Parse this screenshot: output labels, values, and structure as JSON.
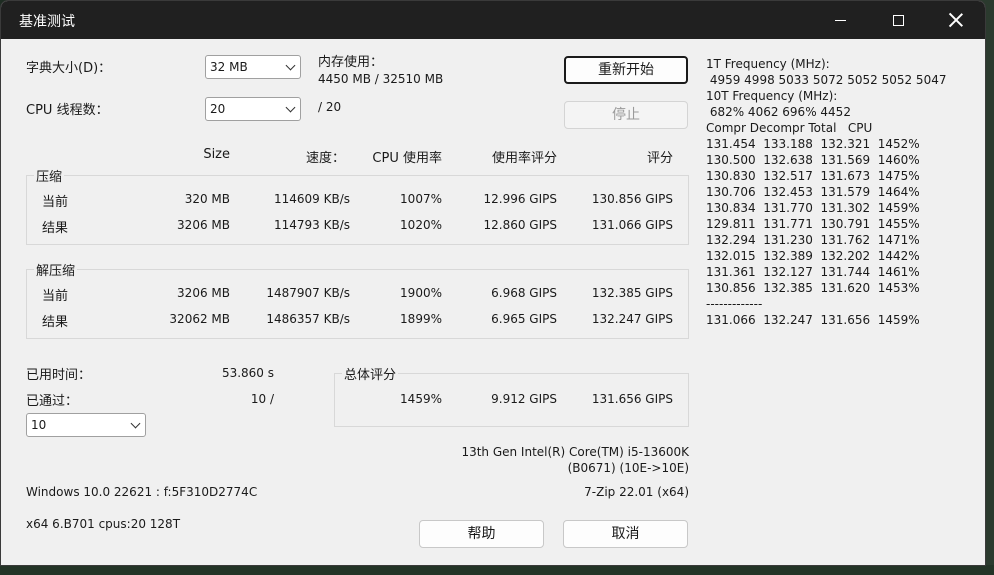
{
  "window": {
    "title": "基准测试"
  },
  "settings": {
    "dict_label": "字典大小(D)：",
    "dict_value": "32 MB",
    "threads_label": "CPU 线程数：",
    "threads_value": "20",
    "threads_max": "/ 20",
    "mem_label": "内存使用：",
    "mem_value": "4450 MB / 32510 MB"
  },
  "buttons": {
    "restart": "重新开始",
    "stop": "停止",
    "help": "帮助",
    "cancel": "取消"
  },
  "columns": {
    "size": "Size",
    "speed": "速度：",
    "cpu": "CPU 使用率",
    "rating_usage": "使用率评分",
    "rating": "评分"
  },
  "compress": {
    "title": "压缩",
    "rows": [
      {
        "label": "当前",
        "size": "320 MB",
        "speed": "114609 KB/s",
        "cpu": "1007%",
        "usage": "12.996 GIPS",
        "rating": "130.856 GIPS"
      },
      {
        "label": "结果",
        "size": "3206 MB",
        "speed": "114793 KB/s",
        "cpu": "1020%",
        "usage": "12.860 GIPS",
        "rating": "131.066 GIPS"
      }
    ]
  },
  "decompress": {
    "title": "解压缩",
    "rows": [
      {
        "label": "当前",
        "size": "3206 MB",
        "speed": "1487907 KB/s",
        "cpu": "1900%",
        "usage": "6.968 GIPS",
        "rating": "132.385 GIPS"
      },
      {
        "label": "结果",
        "size": "32062 MB",
        "speed": "1486357 KB/s",
        "cpu": "1899%",
        "usage": "6.965 GIPS",
        "rating": "132.247 GIPS"
      }
    ]
  },
  "elapsed": {
    "label": "已用时间：",
    "value": "53.860 s"
  },
  "passes": {
    "label": "已通过：",
    "value": "10 /",
    "select_value": "10"
  },
  "total": {
    "title": "总体评分",
    "cpu": "1459%",
    "usage": "9.912 GIPS",
    "rating": "131.656 GIPS"
  },
  "cpu_info": {
    "line1": "13th Gen Intel(R) Core(TM) i5-13600K",
    "line2": "(B0671) (10E->10E)"
  },
  "os_info": "Windows 10.0 22621 : f:5F310D2774C",
  "version": "7-Zip 22.01 (x64)",
  "arch_info": "x64 6.B701 cpus:20 128T",
  "freq_panel": {
    "lines": [
      "1T Frequency (MHz):",
      " 4959 4998 5033 5072 5052 5052 5047",
      "10T Frequency (MHz):",
      " 682% 4062 696% 4452",
      "Compr Decompr Total   CPU",
      "131.454  133.188  132.321  1452%",
      "130.500  132.638  131.569  1460%",
      "130.830  132.517  131.673  1475%",
      "130.706  132.453  131.579  1464%",
      "130.834  131.770  131.302  1459%",
      "129.811  131.771  130.791  1455%",
      "132.294  131.230  131.762  1471%",
      "132.015  132.389  132.202  1442%",
      "131.361  132.127  131.744  1461%",
      "130.856  132.385  131.620  1453%",
      "-------------",
      "131.066  132.247  131.656  1459%"
    ]
  }
}
